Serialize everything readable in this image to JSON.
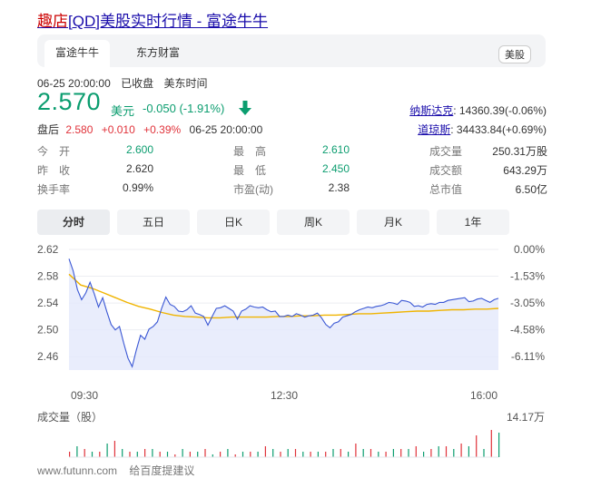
{
  "header": {
    "title_highlight": "趣店",
    "title_rest": "[QD]美股实时行情 - 富途牛牛"
  },
  "source_tabs": {
    "active": "富途牛牛",
    "other": "东方财富",
    "market": "美股"
  },
  "quote": {
    "datetime": "06-25 20:00:00",
    "status": "已收盘",
    "tz": "美东时间",
    "price": "2.570",
    "unit": "美元",
    "change": "-0.050 (-1.91%)",
    "after_label": "盘后",
    "after_price": "2.580",
    "after_change": "+0.010",
    "after_pct": "+0.39%",
    "after_time": "06-25 20:00:00"
  },
  "indices": [
    {
      "name": "纳斯达克",
      "value": ": 14360.39(-0.06%)"
    },
    {
      "name": "道琼斯",
      "value": ": 34433.84(+0.69%)"
    }
  ],
  "stats": [
    {
      "k": "今　开",
      "v": "2.600",
      "green": true
    },
    {
      "k": "最　高",
      "v": "2.610",
      "green": true
    },
    {
      "k": "成交量",
      "v": "250.31万股",
      "green": false
    },
    {
      "k": "昨　收",
      "v": "2.620",
      "green": false
    },
    {
      "k": "最　低",
      "v": "2.450",
      "green": true
    },
    {
      "k": "成交额",
      "v": "643.29万",
      "green": false
    },
    {
      "k": "换手率",
      "v": "0.99%",
      "green": false
    },
    {
      "k": "市盈(动)",
      "v": "2.38",
      "green": false
    },
    {
      "k": "总市值",
      "v": "6.50亿",
      "green": false
    }
  ],
  "kline_tabs": [
    "分时",
    "五日",
    "日K",
    "周K",
    "月K",
    "1年"
  ],
  "footer": {
    "site": "www.futunn.com",
    "suggest": "给百度提建议"
  },
  "chart_data": {
    "type": "line",
    "y_ticks": [
      "2.62",
      "2.58",
      "2.54",
      "2.50",
      "2.46"
    ],
    "y_range": [
      2.44,
      2.62
    ],
    "pct_ticks": [
      "0.00%",
      "-1.53%",
      "-3.05%",
      "-4.58%",
      "-6.11%"
    ],
    "x_ticks": [
      "09:30",
      "12:30",
      "16:00"
    ],
    "volume_label": "成交量（股）",
    "volume_max_label": "14.17万",
    "colors": {
      "price": "#3a57d4",
      "avg": "#f0b400",
      "fill": "#e4e8fb",
      "vol_up": "#e0323a",
      "vol_down": "#0b9d6f"
    },
    "series": [
      {
        "name": "",
        "values": [
          2.606,
          2.588,
          2.56,
          2.545,
          2.555,
          2.571,
          2.554,
          2.534,
          2.548,
          2.527,
          2.508,
          2.5,
          2.505,
          2.48,
          2.458,
          2.445,
          2.47,
          2.492,
          2.486,
          2.501,
          2.505,
          2.512,
          2.532,
          2.549,
          2.538,
          2.535,
          2.528,
          2.527,
          2.53,
          2.536,
          2.525,
          2.523,
          2.52,
          2.507,
          2.52,
          2.532,
          2.533,
          2.536,
          2.532,
          2.528,
          2.516,
          2.528,
          2.531,
          2.536,
          2.534,
          2.533,
          2.534,
          2.53,
          2.527,
          2.528,
          2.52,
          2.52,
          2.522,
          2.52,
          2.524,
          2.522,
          2.519,
          2.521,
          2.522,
          2.525,
          2.518,
          2.508,
          2.503,
          2.51,
          2.512,
          2.519,
          2.521,
          2.523,
          2.527,
          2.53,
          2.532,
          2.534,
          2.533,
          2.535,
          2.536,
          2.538,
          2.541,
          2.54,
          2.538,
          2.544,
          2.543,
          2.541,
          2.535,
          2.536,
          2.534,
          2.538,
          2.539,
          2.538,
          2.541,
          2.541,
          2.544,
          2.545,
          2.546,
          2.547,
          2.548,
          2.542,
          2.543,
          2.546,
          2.547,
          2.544,
          2.541,
          2.545,
          2.547
        ]
      },
      {
        "name": "",
        "values": [
          2.583,
          2.567,
          2.562,
          2.555,
          2.548,
          2.541,
          2.535,
          2.531,
          2.526,
          2.522,
          2.52,
          2.519,
          2.518,
          2.518,
          2.519,
          2.519,
          2.519,
          2.519,
          2.52,
          2.52,
          2.521,
          2.521,
          2.522,
          2.522,
          2.523,
          2.524,
          2.524,
          2.525,
          2.526,
          2.527,
          2.528,
          2.528,
          2.529,
          2.53,
          2.53,
          2.531,
          2.531,
          2.532
        ]
      }
    ],
    "volume_up": [
      0.2,
      0.3,
      0.2,
      0.6,
      0.2,
      0.3,
      0.2,
      0.1,
      0.2,
      0.3,
      0.2,
      0.1,
      0.2,
      0.4,
      0.2,
      0.3,
      0.2,
      0.2,
      0.3,
      0.5,
      0.3,
      0.2,
      0.3,
      0.4,
      0.3,
      0.4,
      0.5,
      0.8,
      1.0
    ],
    "volume_down": [
      0.4,
      0.2,
      0.5,
      0.3,
      0.2,
      0.3,
      0.2,
      0.3,
      0.2,
      0.1,
      0.3,
      0.2,
      0.2,
      0.3,
      0.3,
      0.2,
      0.2,
      0.3,
      0.2,
      0.3,
      0.2,
      0.3,
      0.3,
      0.2,
      0.4,
      0.3,
      0.4,
      0.3,
      0.9
    ]
  }
}
